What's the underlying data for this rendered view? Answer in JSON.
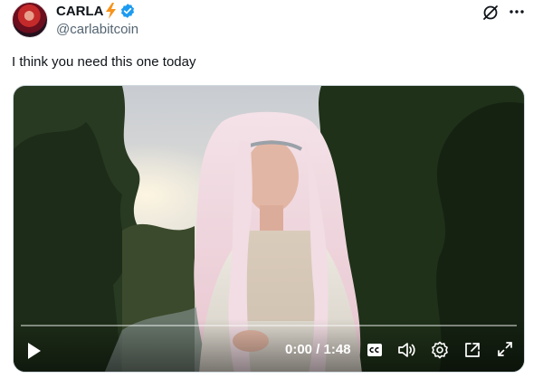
{
  "author": {
    "display_name": "CARLA",
    "handle": "@carlabitcoin"
  },
  "post": {
    "text": "I think you need this one today"
  },
  "video": {
    "time": "0:00 / 1:48"
  },
  "icons": {
    "name_badge": "lightning-bolt-icon",
    "verified": "verified-icon",
    "grok": "grok-icon",
    "more": "more-icon",
    "play": "play-icon",
    "captions": "cc-icon",
    "volume": "volume-icon",
    "settings": "gear-icon",
    "pip": "picture-in-picture-icon",
    "fullscreen": "fullscreen-icon"
  },
  "colors": {
    "verified_blue": "#1d9bf0",
    "bolt_orange": "#f7931a",
    "text_primary": "#0f1419",
    "text_secondary": "#536471"
  }
}
